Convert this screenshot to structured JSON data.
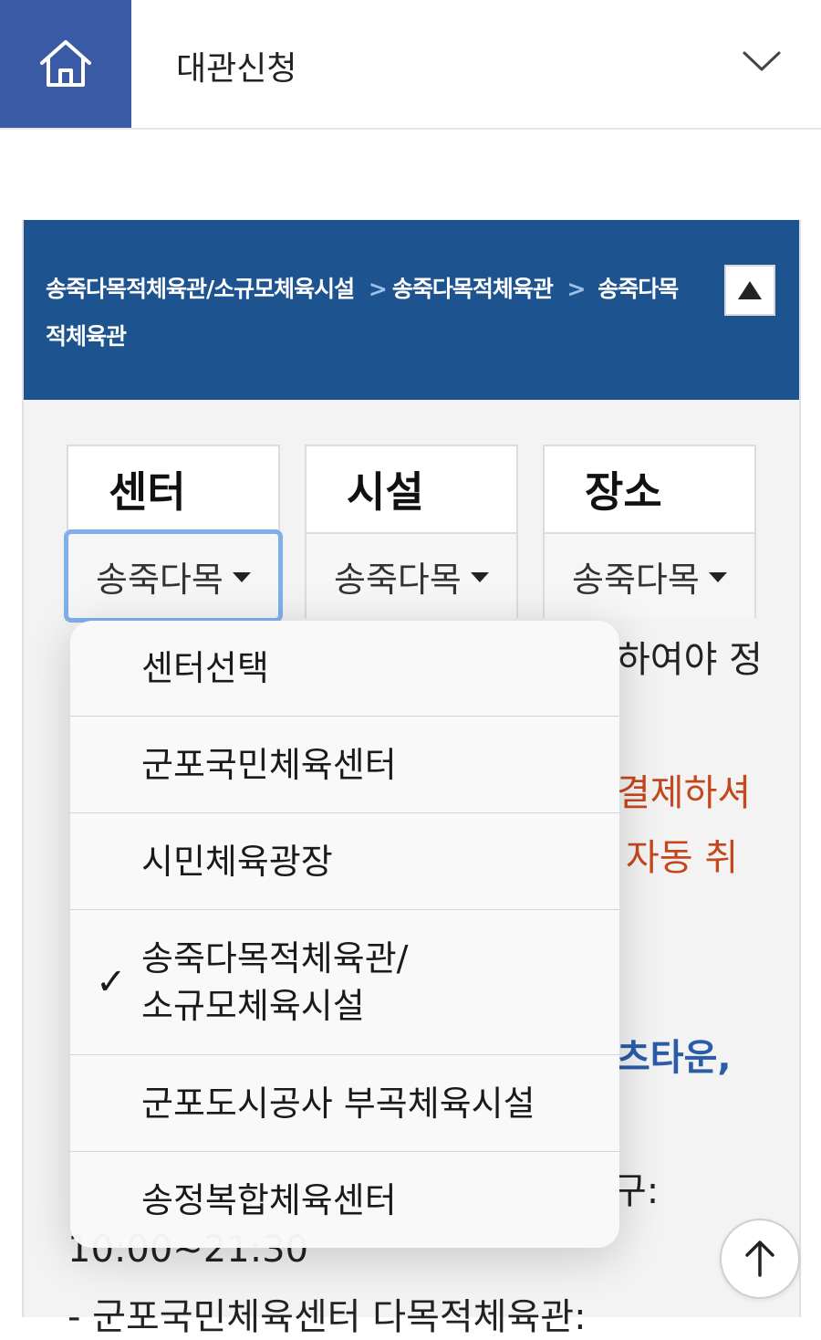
{
  "topbar": {
    "title": "대관신청",
    "home_icon": "home-icon",
    "dropdown_icon": "chevron-down-icon"
  },
  "panel": {
    "breadcrumb": {
      "part1": "송죽다목적체육관/소규모체육시설",
      "sep1": ">",
      "part2": "송죽다목적체육관",
      "sep2": ">",
      "part3": "송죽다목적체육관"
    },
    "collapse_icon": "triangle-up-icon",
    "selectors": [
      {
        "label": "센터",
        "value": "송죽다목"
      },
      {
        "label": "시설",
        "value": "송죽다목"
      },
      {
        "label": "장소",
        "value": "송죽다목"
      }
    ],
    "partial_text": {
      "line1": "하여야 정",
      "line2": "결제하셔",
      "line3": "자동 취",
      "line4": "츠타운,",
      "line5": "구:",
      "line6": "10:00~21:30",
      "line7": "- 군포국민체육센터 다목적체육관:"
    }
  },
  "dropdown": {
    "options": [
      {
        "label": "센터선택",
        "selected": false
      },
      {
        "label": "군포국민체육센터",
        "selected": false
      },
      {
        "label": "시민체육광장",
        "selected": false
      },
      {
        "label": "송죽다목적체육관/\n소규모체육시설",
        "selected": true
      },
      {
        "label": "군포도시공사 부곡체육시설",
        "selected": false
      },
      {
        "label": "송정복합체육센터",
        "selected": false
      }
    ],
    "check_mark": "✓"
  },
  "scroll_top_icon": "arrow-up-icon",
  "colors": {
    "home_bg": "#3b5aa5",
    "header_bg": "#1d5490",
    "accent_red": "#c4471e",
    "accent_blue": "#2a5ca8"
  }
}
